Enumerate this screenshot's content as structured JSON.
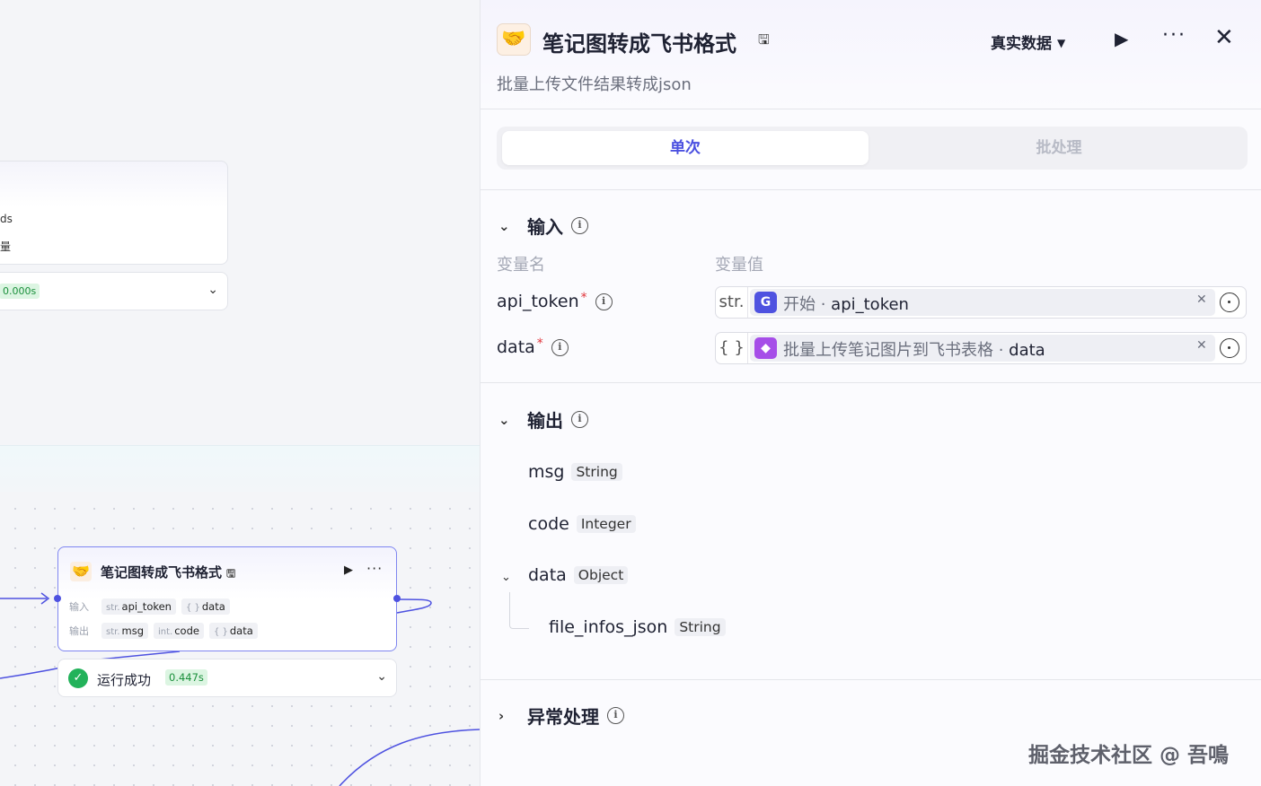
{
  "canvas": {
    "top_card": {
      "line1": "ds",
      "line2": "量",
      "time": "0.000s"
    },
    "node": {
      "title": "笔记图转成飞书格式",
      "input_label": "输入",
      "output_label": "输出",
      "inputs": [
        {
          "type": "str.",
          "name": "api_token"
        },
        {
          "type": "{ }",
          "name": "data"
        }
      ],
      "outputs": [
        {
          "type": "str.",
          "name": "msg"
        },
        {
          "type": "int.",
          "name": "code"
        },
        {
          "type": "{ }",
          "name": "data"
        }
      ],
      "status": "运行成功",
      "time": "0.447s"
    }
  },
  "panel": {
    "title": "笔记图转成飞书格式",
    "subtitle": "批量上传文件结果转成json",
    "data_mode": "真实数据",
    "tabs": {
      "single": "单次",
      "batch": "批处理"
    },
    "input_section": {
      "title": "输入",
      "col_name": "变量名",
      "col_value": "变量值",
      "vars": [
        {
          "name": "api_token",
          "type": "str.",
          "ref_source": "开始",
          "ref_sep": " · ",
          "ref_field": "api_token",
          "icon_color": "#4e52e0"
        },
        {
          "name": "data",
          "type": "{ }",
          "ref_source": "批量上传笔记图片到飞书表格",
          "ref_sep": " · ",
          "ref_field": "data",
          "icon_color": "#a64ee8"
        }
      ]
    },
    "output_section": {
      "title": "输出",
      "items": [
        {
          "name": "msg",
          "type": "String"
        },
        {
          "name": "code",
          "type": "Integer"
        },
        {
          "name": "data",
          "type": "Object"
        },
        {
          "name": "file_infos_json",
          "type": "String"
        }
      ]
    },
    "error_section": {
      "title": "异常处理"
    }
  },
  "watermark": "掘金技术社区 @ 吾鳴"
}
